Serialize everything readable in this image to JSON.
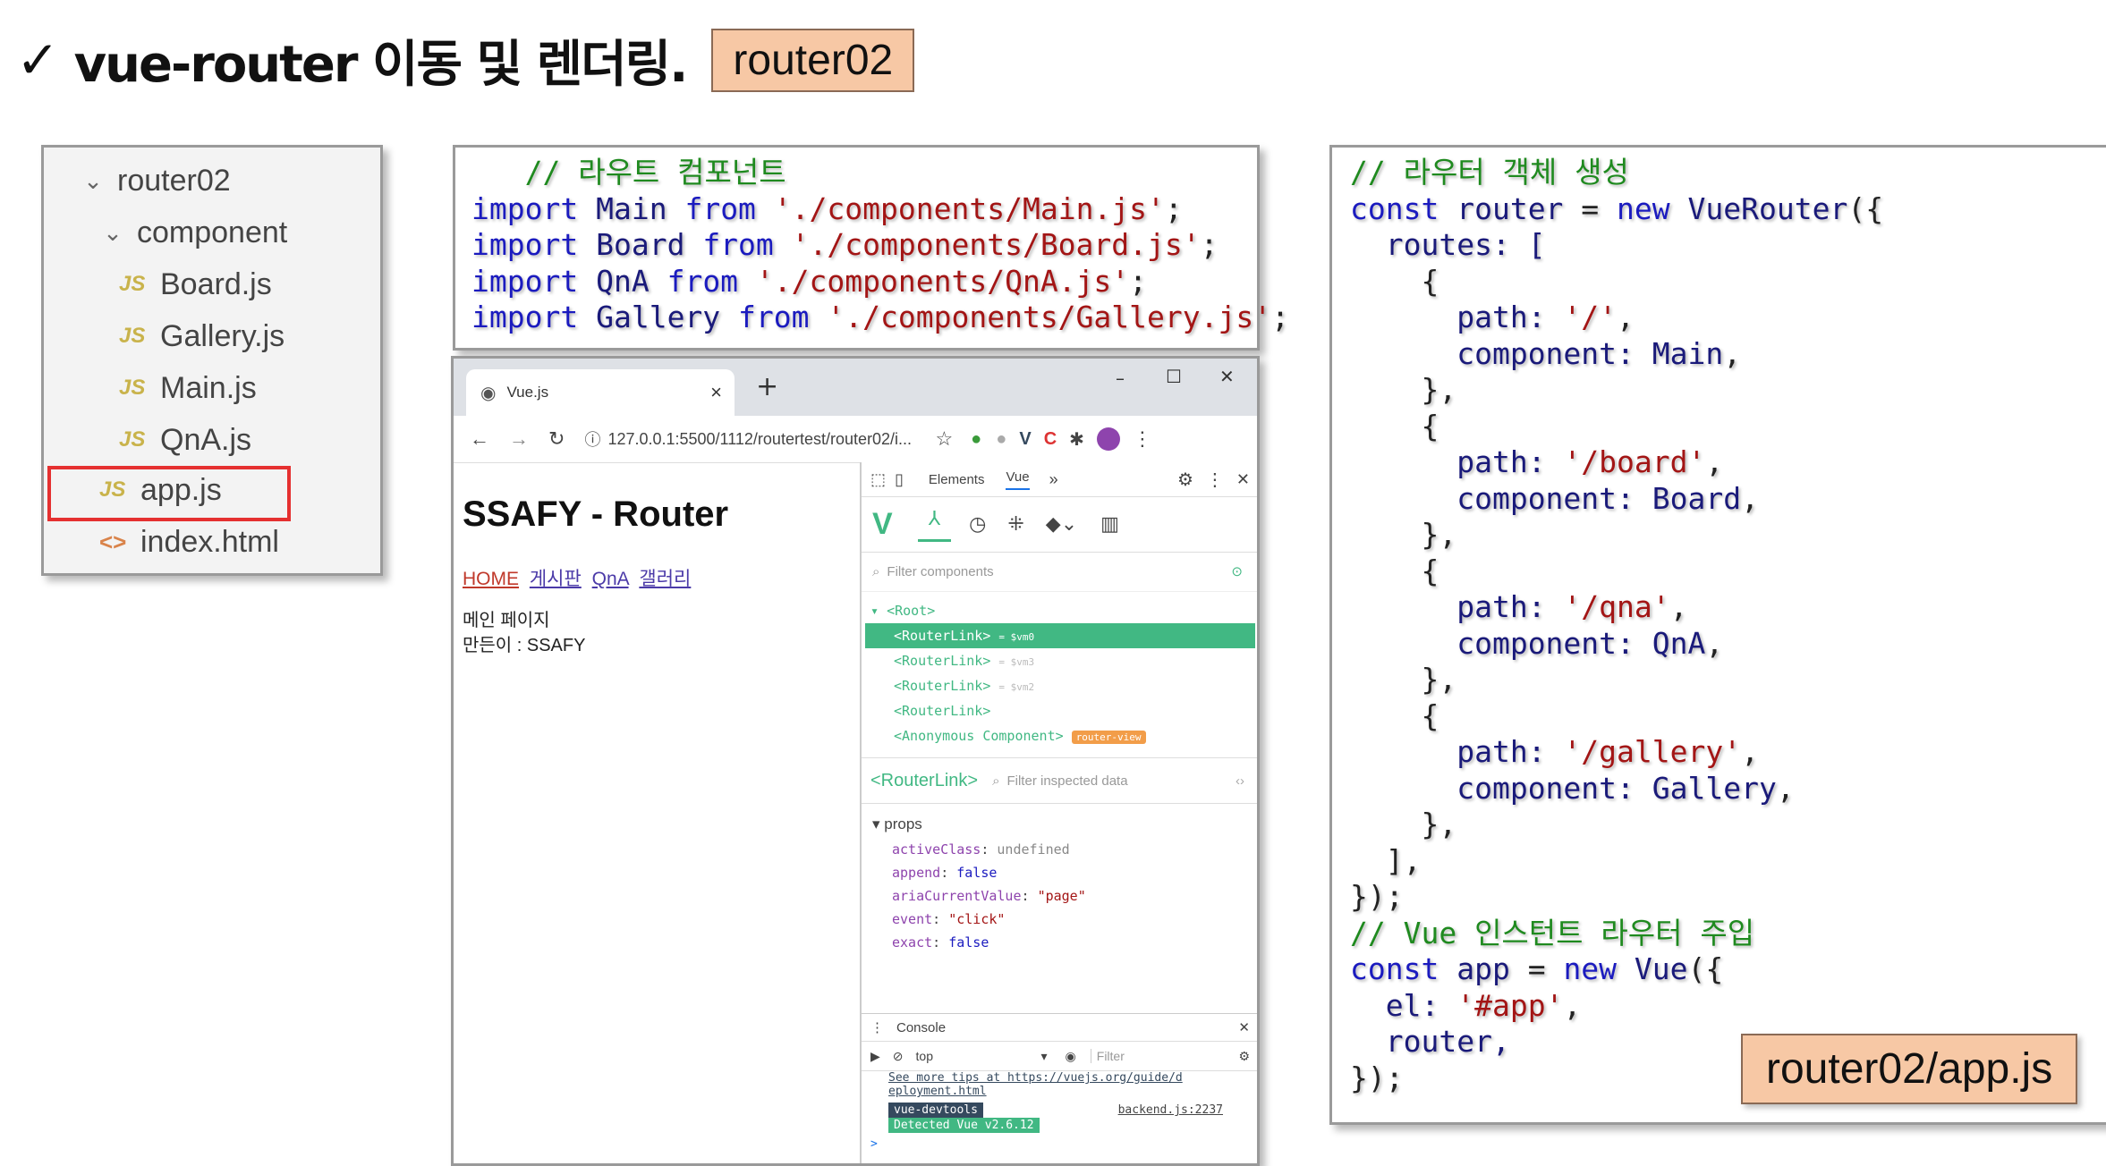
{
  "title": {
    "check": "✓",
    "text": "vue-router 이동 및 렌더링.",
    "badge": "router02"
  },
  "tree": {
    "items": [
      {
        "kind": "folder",
        "label": "router02",
        "indent": 0
      },
      {
        "kind": "folder",
        "label": "component",
        "indent": 1
      },
      {
        "kind": "js",
        "label": "Board.js",
        "indent": 2
      },
      {
        "kind": "js",
        "label": "Gallery.js",
        "indent": 2
      },
      {
        "kind": "js",
        "label": "Main.js",
        "indent": 2
      },
      {
        "kind": "js",
        "label": "QnA.js",
        "indent": 2
      },
      {
        "kind": "js",
        "label": "app.js",
        "indent": 1
      },
      {
        "kind": "html",
        "label": "index.html",
        "indent": 1
      }
    ],
    "js_badge": "JS",
    "html_badge": "<>"
  },
  "imports": {
    "comment": "// 라우트 컴포넌트",
    "lines": [
      {
        "kw": "import",
        "name": "Main",
        "from": "from",
        "path": "'./components/Main.js'",
        "end": ";"
      },
      {
        "kw": "import",
        "name": "Board",
        "from": "from",
        "path": "'./components/Board.js'",
        "end": ";"
      },
      {
        "kw": "import",
        "name": "QnA",
        "from": "from",
        "path": "'./components/QnA.js'",
        "end": ";"
      },
      {
        "kw": "import",
        "name": "Gallery",
        "from": "from",
        "path": "'./components/Gallery.js'",
        "end": ";"
      }
    ]
  },
  "routes_code": {
    "comment1": "// 라우터 객체 생성",
    "const1": "const",
    "router_var": "router",
    "eq1": " = ",
    "new1": "new",
    "ctor1": "VueRouter",
    "open1": "({",
    "routes_key": "routes: [",
    "routes": [
      {
        "path": "'/'",
        "component": "Main"
      },
      {
        "path": "'/board'",
        "component": "Board"
      },
      {
        "path": "'/qna'",
        "component": "QnA"
      },
      {
        "path": "'/gallery'",
        "component": "Gallery"
      }
    ],
    "path_key": "path: ",
    "component_key": "component: ",
    "brace_open": "{",
    "brace_close": "},",
    "routes_close": "],",
    "close1": "});",
    "comment2": "// Vue 인스턴트 라우터 주입",
    "const2": "const",
    "app_var": "app",
    "new2": "new",
    "ctor2": "Vue",
    "open2": "({",
    "el_key": "el: ",
    "el_val": "'#app'",
    "comma": ",",
    "router_line": "router,",
    "close2": "});"
  },
  "browser": {
    "tab_title": "Vue.js",
    "tab_close": "×",
    "new_tab": "+",
    "win_minimize": "–",
    "win_maximize": "☐",
    "win_close": "✕",
    "url": "127.0.0.1:5500/1112/routertest/router02/i...",
    "page": {
      "heading": "SSAFY - Router",
      "links": [
        "HOME",
        "게시판",
        "QnA",
        "갤러리"
      ],
      "content_line1": "메인 페이지",
      "content_line2": "만든이 : SSAFY"
    },
    "devtools": {
      "tabs": [
        "Elements",
        "Vue"
      ],
      "more": "»",
      "filter_components": "Filter components",
      "tree": [
        {
          "label": "<Root>",
          "suffix": "",
          "selected": false
        },
        {
          "label": "<RouterLink>",
          "suffix": "= $vm0",
          "selected": true
        },
        {
          "label": "<RouterLink>",
          "suffix": "= $vm3",
          "selected": false
        },
        {
          "label": "<RouterLink>",
          "suffix": "= $vm2",
          "selected": false
        },
        {
          "label": "<RouterLink>",
          "suffix": "",
          "selected": false
        },
        {
          "label": "<Anonymous Component>",
          "suffix": "router-view",
          "selected": false
        }
      ],
      "inspected": "<RouterLink>",
      "filter_inspected": "Filter inspected data",
      "props_header": "props",
      "props": [
        {
          "key": "activeClass",
          "value": "undefined"
        },
        {
          "key": "append",
          "value": "false"
        },
        {
          "key": "ariaCurrentValue",
          "value": "\"page\""
        },
        {
          "key": "event",
          "value": "\"click\""
        },
        {
          "key": "exact",
          "value": "false"
        }
      ],
      "console_title": "Console",
      "console_context": "top",
      "console_filter": "Filter",
      "console_lines": [
        "See more tips at https://vuejs.org/guide/d",
        "eployment.html"
      ],
      "devtools_badge": "vue-devtools",
      "backend_link": "backend.js:2237",
      "detected_badge": "Detected Vue v2.6.12",
      "prompt": ">"
    }
  },
  "result_badge": "router02/app.js",
  "colors": {
    "keyword": "#1b1bbf",
    "string": "#a31515",
    "comment": "#1f8a1f",
    "vue_green": "#41b883",
    "badge_bg": "#f7c8a5",
    "highlight_red": "#e53030"
  }
}
